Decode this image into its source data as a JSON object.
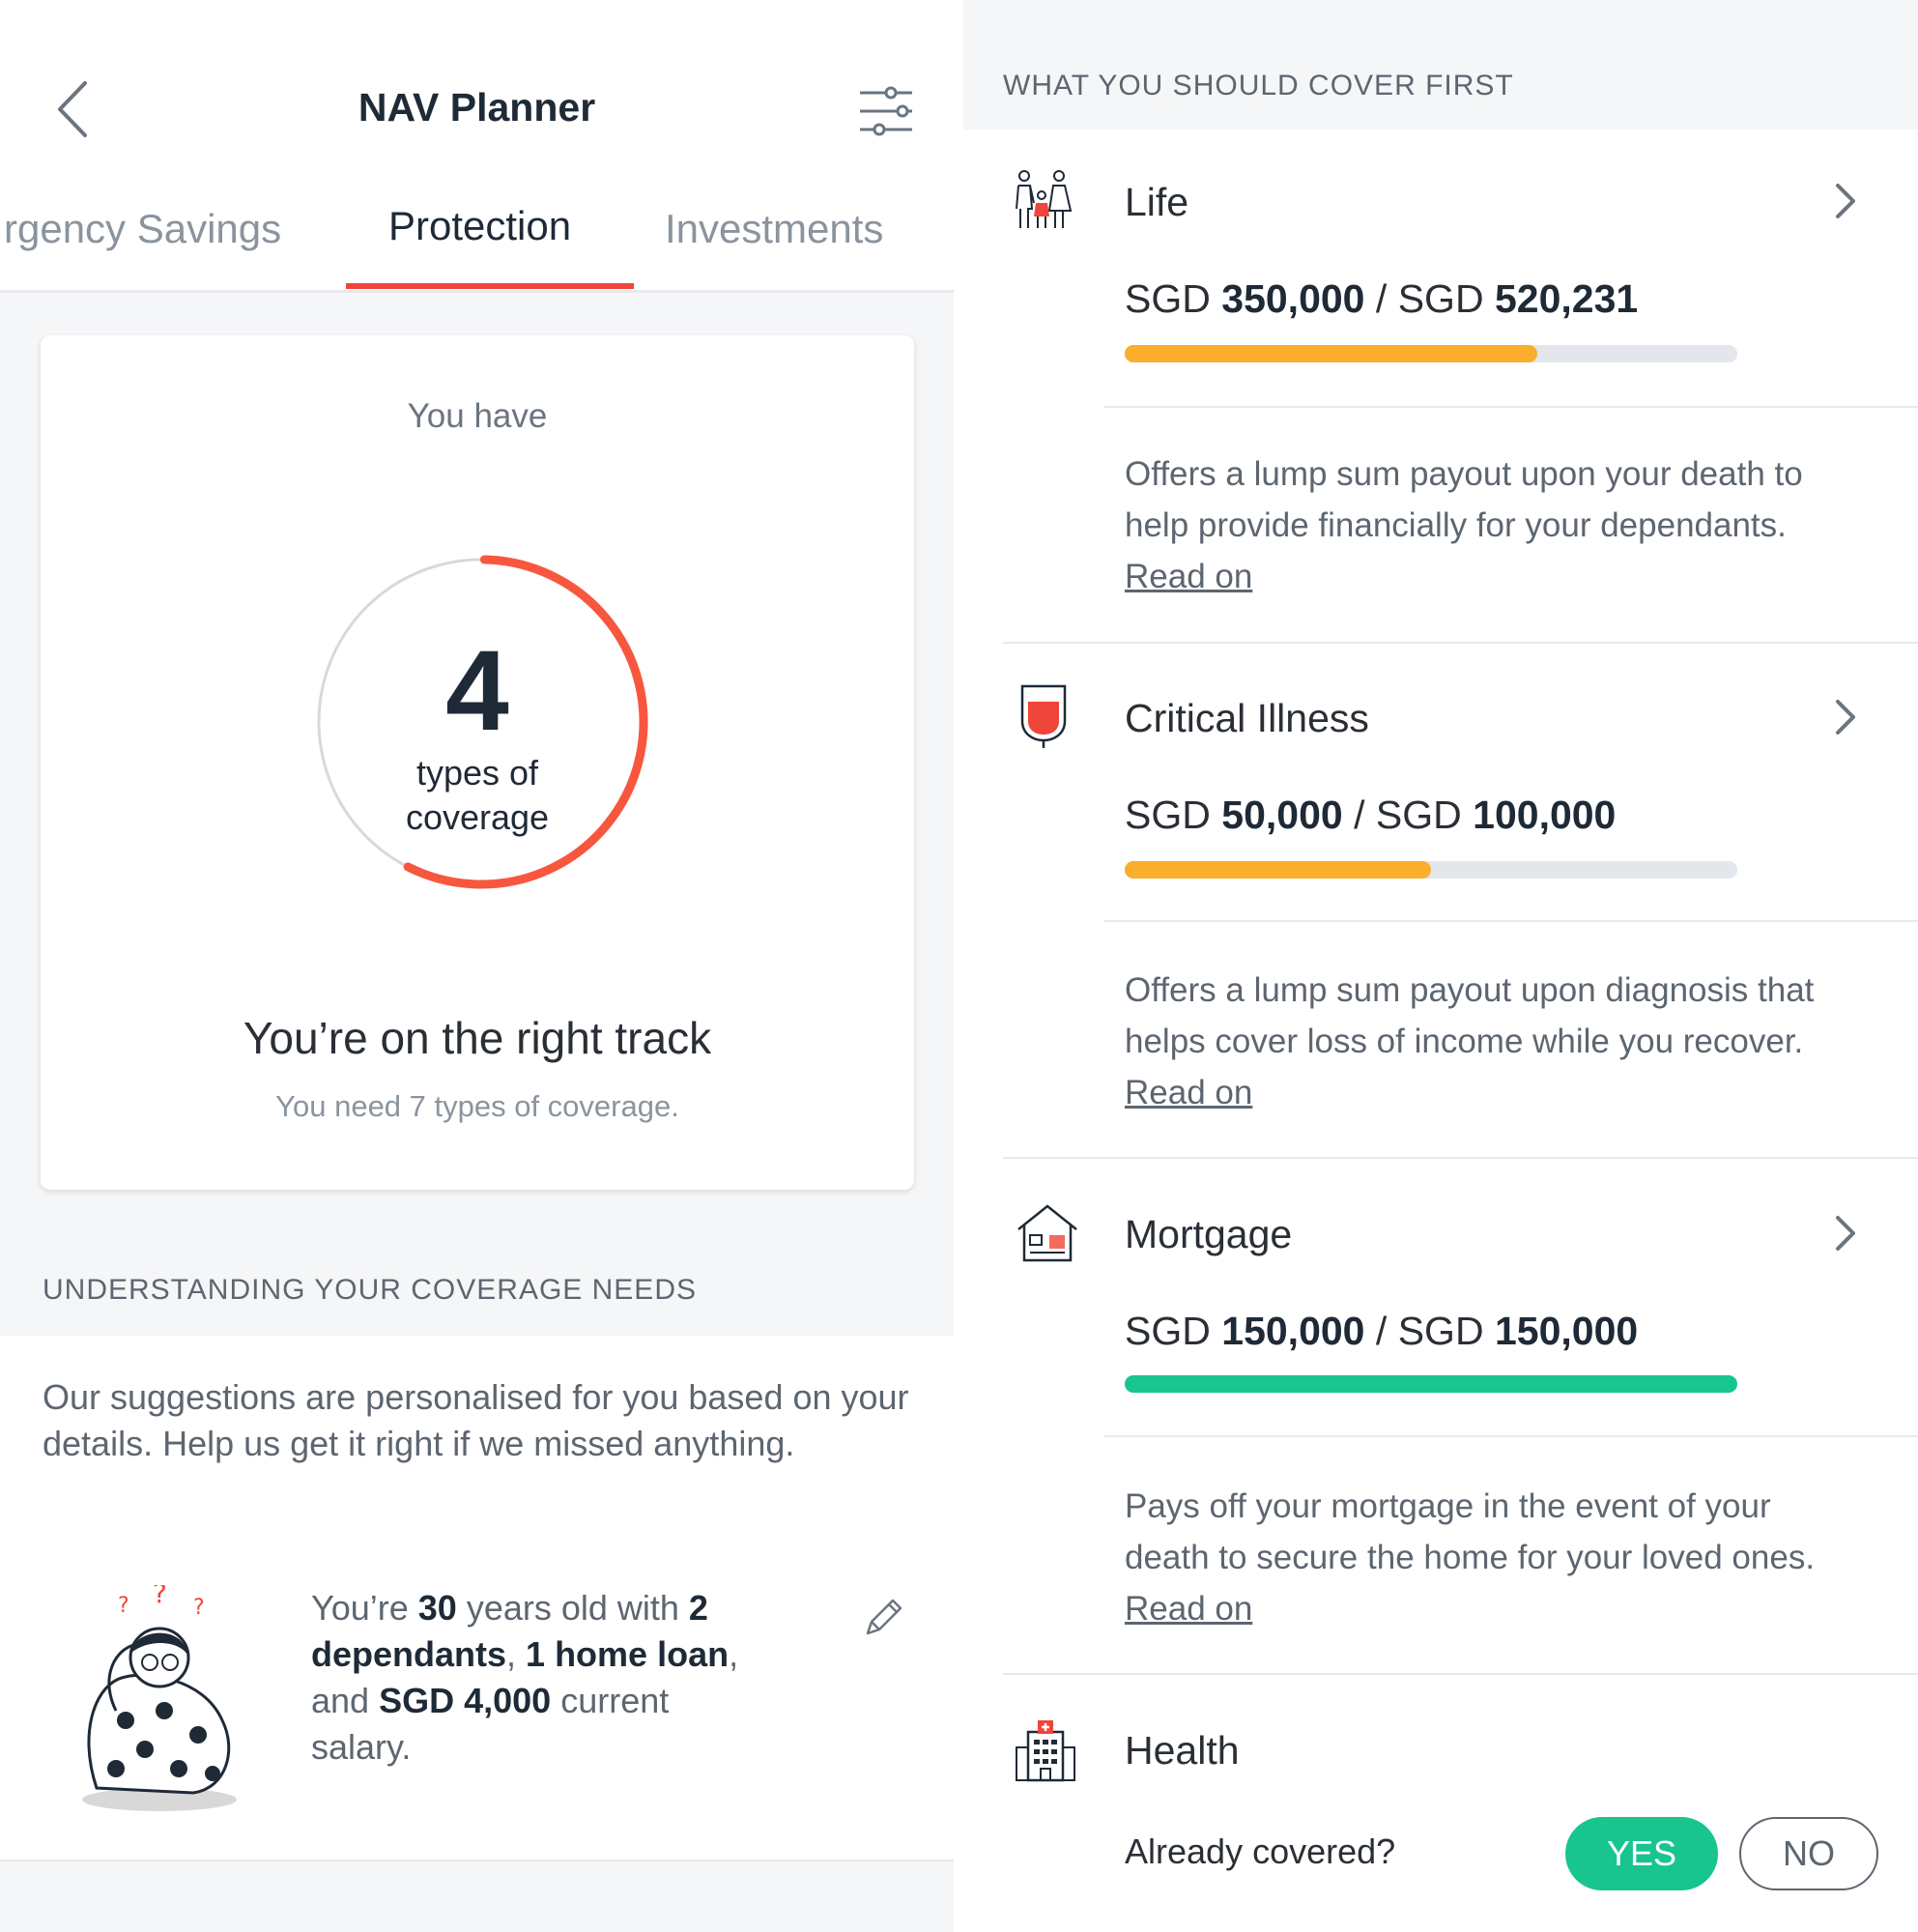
{
  "header": {
    "title": "NAV Planner",
    "tabs": [
      {
        "label": "rgency Savings",
        "active": false
      },
      {
        "label": "Protection",
        "active": true
      },
      {
        "label": "Investments",
        "active": false
      }
    ],
    "accent_color": "#f0453a"
  },
  "summary": {
    "you_have": "You have",
    "count": "4",
    "count_label_1": "types of",
    "count_label_2": "coverage",
    "progress_fraction": 0.5714,
    "status": "You’re on the right track",
    "need": "You need 7 types of coverage."
  },
  "understanding": {
    "heading": "UNDERSTANDING YOUR COVERAGE NEEDS",
    "suggestion": "Our suggestions are personalised for you based on your details. Help us get it right if we missed anything.",
    "profile": {
      "p1": "You’re ",
      "age": "30",
      "p2": " years old with ",
      "dependants": "2 dependants",
      "p3": ", ",
      "loans": "1 home loan",
      "p4": ", and ",
      "salary": "SGD 4,000",
      "p5": " current salary."
    }
  },
  "cover_first": {
    "heading": "WHAT YOU SHOULD COVER FIRST",
    "items": [
      {
        "name": "Life",
        "icon": "family-icon",
        "currency1": "SGD",
        "have": "350,000",
        "sep": "/",
        "currency2": "SGD",
        "need": "520,231",
        "fraction": 0.6728,
        "bar_color": "#fbad2c",
        "desc": "Offers a lump sum payout upon your death to help provide financially for your dependants.",
        "read_on": "Read on"
      },
      {
        "name": "Critical Illness",
        "icon": "blood-bag-icon",
        "currency1": "SGD",
        "have": "50,000",
        "sep": "/",
        "currency2": "SGD",
        "need": "100,000",
        "fraction": 0.5,
        "bar_color": "#fbad2c",
        "desc": "Offers a lump sum payout upon diagnosis that helps cover loss of income while you recover.",
        "read_on": "Read on"
      },
      {
        "name": "Mortgage",
        "icon": "house-icon",
        "currency1": "SGD",
        "have": "150,000",
        "sep": "/",
        "currency2": "SGD",
        "need": "150,000",
        "fraction": 1.0,
        "bar_color": "#18c58f",
        "desc": "Pays off your mortgage in the event of your death to secure the home for your loved ones.",
        "read_on": "Read on"
      }
    ],
    "health": {
      "name": "Health",
      "icon": "hospital-icon",
      "question": "Already covered?",
      "yes": "YES",
      "no": "NO"
    }
  }
}
